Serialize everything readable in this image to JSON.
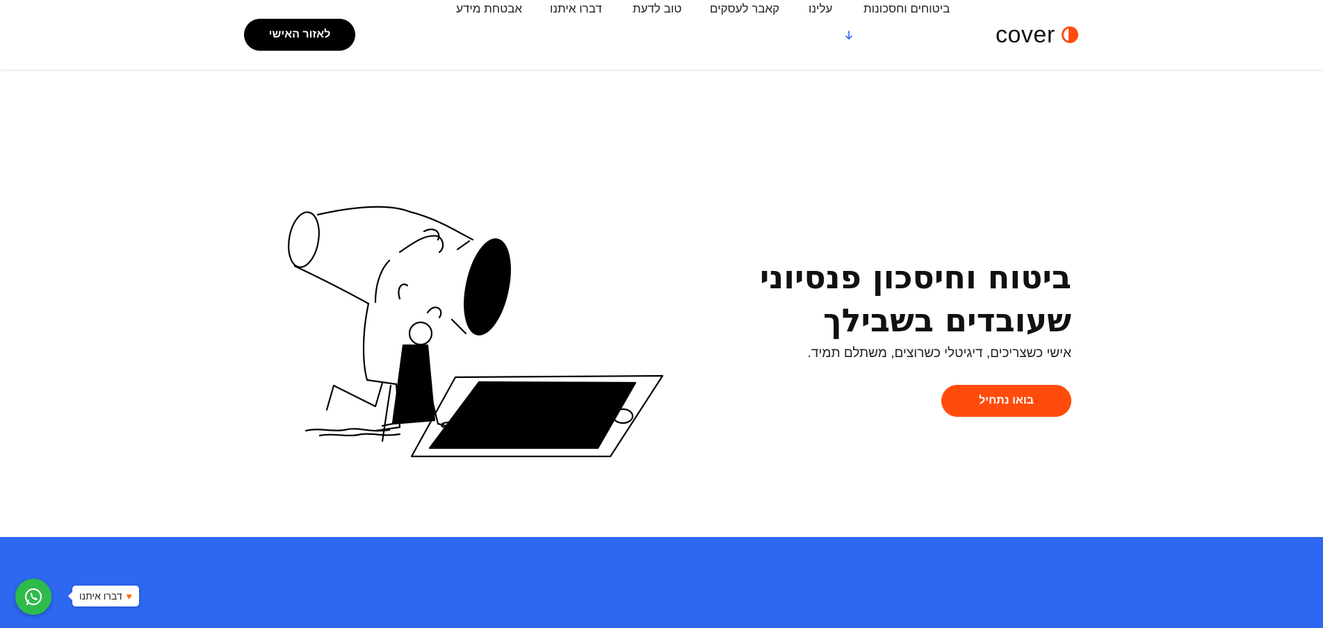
{
  "header": {
    "logo_text": "cover",
    "nav": [
      {
        "label": "ביטוחים וחסכונות",
        "has_dropdown": true
      },
      {
        "label": "עלינו"
      },
      {
        "label": "קאבר לעסקים"
      },
      {
        "label": "טוב לדעת"
      },
      {
        "label": "דברו איתנו"
      },
      {
        "label": "אבטחת מידע"
      }
    ],
    "account_button": "לאזור האישי"
  },
  "hero": {
    "title_line1": "ביטוח וחיסכון פנסיוני",
    "title_line2": "שעובדים בשבילך",
    "subtitle": "אישי כשצריכים, דיגיטלי כשרוצים, משתלם תמיד.",
    "cta": "בואו נתחיל"
  },
  "chat_widget": {
    "label": "דברו איתנו",
    "icon": "whatsapp-icon"
  },
  "colors": {
    "brand_orange": "#ff4c0c",
    "band_blue": "#2e67f0",
    "whatsapp_green": "#2dbb4c",
    "nav_arrow_blue": "#2e67f0"
  }
}
